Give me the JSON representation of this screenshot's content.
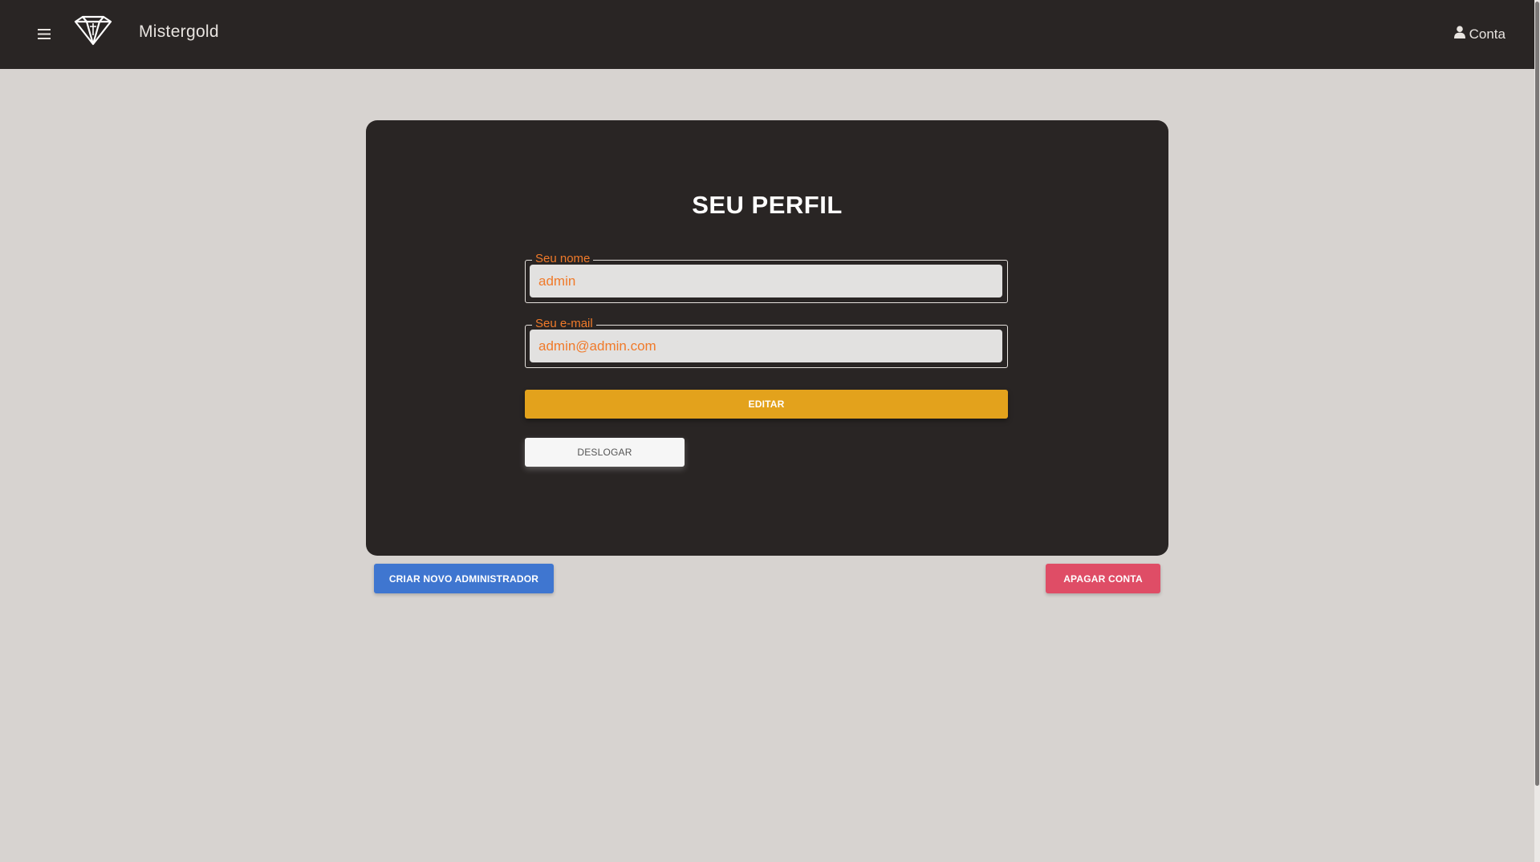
{
  "header": {
    "brand": "Mistergold",
    "account_label": "Conta",
    "menu_icon": "hamburger-menu-icon",
    "logo_icon": "diamond-icon",
    "account_icon": "user-icon"
  },
  "profile": {
    "title": "SEU PERFIL",
    "name_field": {
      "label": "Seu nome",
      "value": "admin"
    },
    "email_field": {
      "label": "Seu e-mail",
      "value": "admin@admin.com"
    },
    "edit_label": "EDITAR",
    "logout_label": "DESLOGAR"
  },
  "actions": {
    "create_admin_label": "CRIAR NOVO ADMINISTRADOR",
    "delete_account_label": "APAGAR CONTA"
  },
  "colors": {
    "header_bg": "#292524",
    "page_bg": "#d7d3d0",
    "accent_orange": "#f07a2a",
    "edit_button": "#e3a21c",
    "create_admin_button": "#3f76d0",
    "delete_button": "#df4d66"
  }
}
